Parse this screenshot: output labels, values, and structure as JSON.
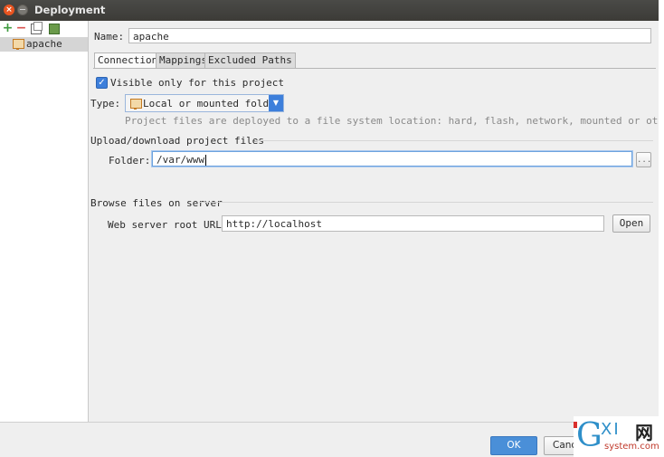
{
  "window": {
    "title": "Deployment"
  },
  "sidebar": {
    "tools": [
      "add-icon",
      "remove-icon",
      "copy-icon",
      "use-as-default-icon"
    ],
    "items": [
      {
        "label": "apache",
        "icon": "server-folder-icon",
        "selected": true
      }
    ]
  },
  "name_field": {
    "label": "Name:",
    "value": "apache"
  },
  "tabs": [
    {
      "label": "Connection",
      "active": true
    },
    {
      "label": "Mappings",
      "active": false
    },
    {
      "label": "Excluded Paths",
      "active": false
    }
  ],
  "connection": {
    "visible_only_label": "Visible only for this project",
    "visible_only_checked": true,
    "type_label": "Type:",
    "type_value": "Local or mounted folder",
    "type_hint": "Project files are deployed to a file system location: hard, flash, network, mounted or other drive.",
    "upload_section": "Upload/download project files",
    "folder_label": "Folder:",
    "folder_value": "/var/www",
    "browse_label": "...",
    "browse_section": "Browse files on server",
    "web_root_label": "Web server root URL:",
    "web_root_value": "http://localhost",
    "open_label": "Open"
  },
  "footer": {
    "ok_label": "OK",
    "cancel_label": "Canc"
  },
  "watermark": {
    "g": "G",
    "xi": "XI",
    "net": "网",
    "sub": "system.com"
  },
  "colors": {
    "accent": "#3d7fdb",
    "title_bar": "#3c3b37",
    "close_button": "#e95420"
  }
}
